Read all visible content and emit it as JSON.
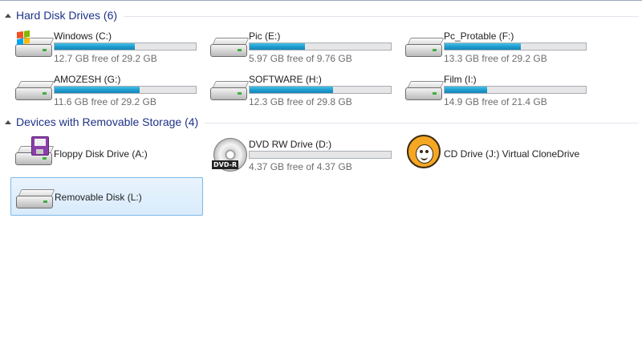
{
  "groups": {
    "hdd": {
      "title": "Hard Disk Drives (6)"
    },
    "removable": {
      "title": "Devices with Removable Storage (4)"
    }
  },
  "drives": [
    {
      "name": "Windows (C:)",
      "free": "12.7 GB free of 29.2 GB",
      "used_fraction": 0.57,
      "icon": "windows-hard-drive-icon"
    },
    {
      "name": "Pic (E:)",
      "free": "5.97 GB free of 9.76 GB",
      "used_fraction": 0.39,
      "icon": "hard-drive-icon"
    },
    {
      "name": "Pc_Protable  (F:)",
      "free": "13.3 GB free of 29.2 GB",
      "used_fraction": 0.54,
      "icon": "hard-drive-icon"
    },
    {
      "name": "AMOZESH (G:)",
      "free": "11.6 GB free of 29.2 GB",
      "used_fraction": 0.6,
      "icon": "hard-drive-icon"
    },
    {
      "name": "SOFTWARE (H:)",
      "free": "12.3 GB free of 29.8 GB",
      "used_fraction": 0.59,
      "icon": "hard-drive-icon"
    },
    {
      "name": "Film (I:)",
      "free": "14.9 GB free of 21.4 GB",
      "used_fraction": 0.3,
      "icon": "hard-drive-icon"
    }
  ],
  "devices": [
    {
      "name": "Floppy Disk Drive (A:)",
      "icon": "floppy-drive-icon"
    },
    {
      "name": "DVD RW Drive (D:)",
      "free": "4.37 GB free of 4.37 GB",
      "used_fraction": 0.0,
      "icon": "dvd-drive-icon",
      "icon_text": "DVD-R"
    },
    {
      "name": "CD Drive (J:) Virtual CloneDrive",
      "icon": "clonedrive-sheep-icon"
    },
    {
      "name": "Removable Disk (L:)",
      "icon": "removable-disk-icon",
      "selected": true
    }
  ],
  "colors": {
    "header_text": "#1e3287",
    "bar_fill": "#1d9bcf",
    "selection": "#d9ebfb"
  }
}
